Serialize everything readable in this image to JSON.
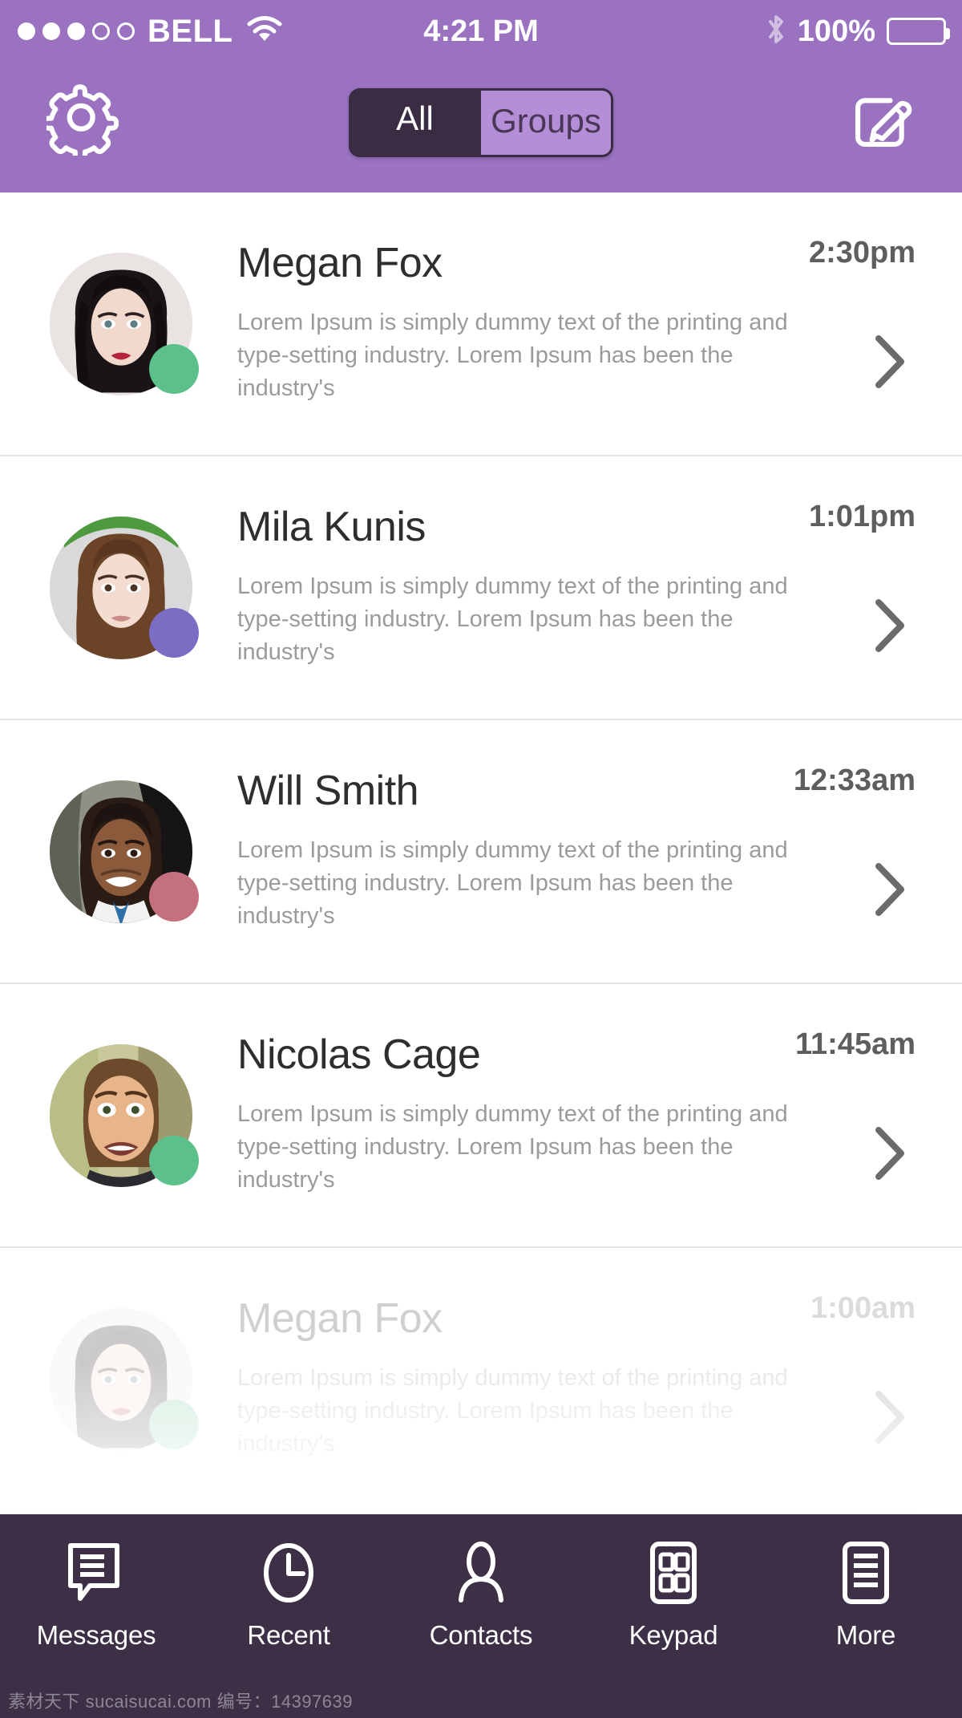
{
  "status_bar": {
    "carrier": "BELL",
    "signal_filled": 3,
    "signal_empty": 2,
    "wifi_icon": "wifi-icon",
    "time": "4:21 PM",
    "bluetooth_icon": "bluetooth-icon",
    "battery_percent": "100%",
    "battery_icon": "battery-full-icon"
  },
  "navbar": {
    "settings_icon": "gear-icon",
    "compose_icon": "compose-icon",
    "segments": [
      {
        "label": "All",
        "active": true
      },
      {
        "label": "Groups",
        "active": false
      }
    ]
  },
  "colors": {
    "header_purple": "#9a72c0",
    "dark_purple": "#3a2d43",
    "tabbar": "#3c2f46",
    "segment_inactive": "#b58ed8",
    "status_online": "#5cc08a",
    "status_busy": "#7b6cc4",
    "status_away": "#c4707f",
    "divider": "#e2e2e2",
    "name_text": "#2e2e2e",
    "preview_text": "#9b9b9b",
    "time_text": "#5e5e5e"
  },
  "conversations": [
    {
      "name": "Megan Fox",
      "time": "2:30pm",
      "preview": "Lorem Ipsum is simply dummy text of the printing and type-setting industry. Lorem Ipsum has been the industry's",
      "status_color": "#5cc08a",
      "avatar": "megan-fox",
      "faded": false
    },
    {
      "name": "Mila Kunis",
      "time": "1:01pm",
      "preview": "Lorem Ipsum is simply dummy text of the printing and type-setting industry. Lorem Ipsum has been the industry's",
      "status_color": "#7b6cc4",
      "avatar": "mila-kunis",
      "faded": false
    },
    {
      "name": "Will Smith",
      "time": "12:33am",
      "preview": "Lorem Ipsum is simply dummy text of the printing and type-setting industry. Lorem Ipsum has been the industry's",
      "status_color": "#c4707f",
      "avatar": "will-smith",
      "faded": false
    },
    {
      "name": "Nicolas Cage",
      "time": "11:45am",
      "preview": "Lorem Ipsum is simply dummy text of the printing and type-setting industry. Lorem Ipsum has been the industry's",
      "status_color": "#5cc08a",
      "avatar": "nicolas-cage",
      "faded": false
    },
    {
      "name": "Megan Fox",
      "time": "1:00am",
      "preview": "Lorem Ipsum is simply dummy text of the printing and type-setting industry. Lorem Ipsum has been the industry's",
      "status_color": "#5cc08a",
      "avatar": "megan-fox",
      "faded": true
    }
  ],
  "tabbar": {
    "items": [
      {
        "label": "Messages",
        "icon": "messages-icon"
      },
      {
        "label": "Recent",
        "icon": "clock-icon"
      },
      {
        "label": "Contacts",
        "icon": "person-icon"
      },
      {
        "label": "Keypad",
        "icon": "keypad-icon"
      },
      {
        "label": "More",
        "icon": "list-icon"
      }
    ]
  },
  "watermark": "素材天下 sucaisucai.com 编号：14397639"
}
